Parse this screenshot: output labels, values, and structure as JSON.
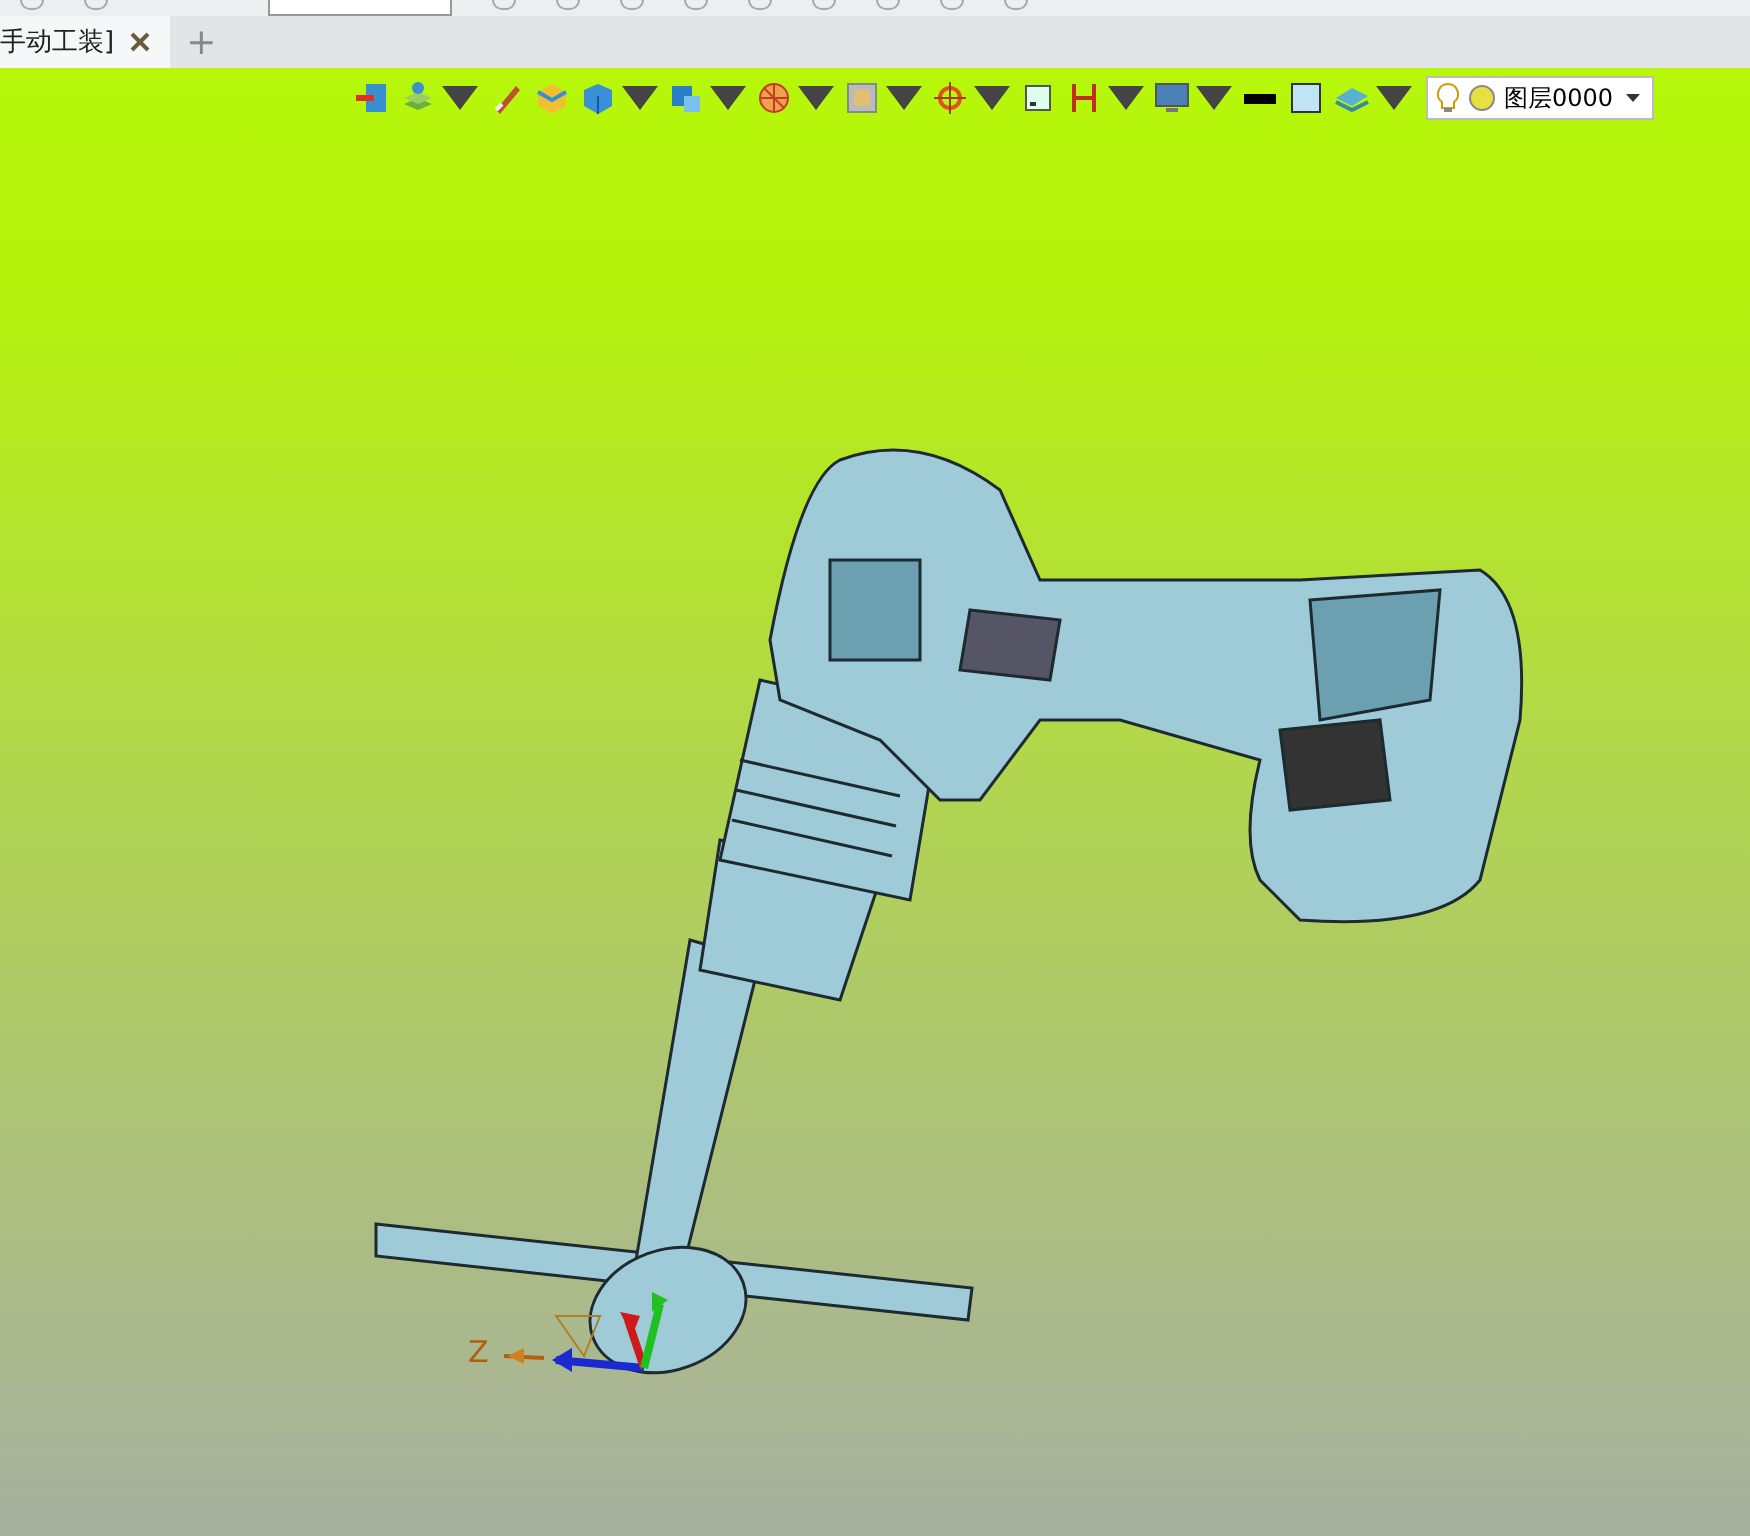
{
  "tabs": [
    {
      "label": "手动工装]",
      "selected": true
    }
  ],
  "new_tab": "+",
  "toolbar": {
    "tools": [
      {
        "kind": "exit",
        "dropdown": false
      },
      {
        "kind": "layers",
        "dropdown": true
      },
      {
        "kind": "brush",
        "dropdown": false
      },
      {
        "kind": "box",
        "dropdown": false
      },
      {
        "kind": "cube",
        "dropdown": true
      },
      {
        "kind": "view",
        "dropdown": true
      },
      {
        "kind": "sphere",
        "dropdown": true
      },
      {
        "kind": "frame",
        "dropdown": true
      },
      {
        "kind": "target",
        "dropdown": true
      },
      {
        "kind": "square",
        "dropdown": false
      },
      {
        "kind": "measure",
        "dropdown": true
      },
      {
        "kind": "monitor",
        "dropdown": true
      },
      {
        "kind": "line",
        "dropdown": false
      },
      {
        "kind": "fill",
        "dropdown": false
      },
      {
        "kind": "stack",
        "dropdown": true
      }
    ]
  },
  "layer": {
    "name": "图层0000"
  },
  "axis": {
    "label": "Z"
  }
}
